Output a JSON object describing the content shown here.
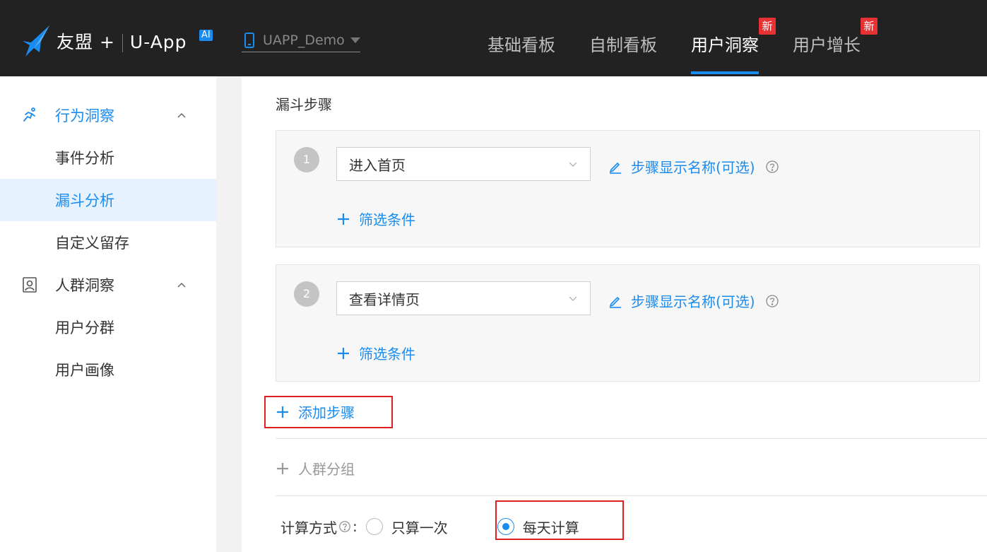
{
  "header": {
    "brand": "友盟",
    "brand_suffix": "+",
    "product": "U-App",
    "ai_badge": "AI",
    "app_selector": {
      "value": "UAPP_Demo"
    },
    "nav": [
      {
        "label": "基础看板",
        "active": false
      },
      {
        "label": "自制看板",
        "active": false
      },
      {
        "label": "用户洞察",
        "active": true,
        "badge": "新"
      },
      {
        "label": "用户增长",
        "active": false,
        "badge": "新"
      }
    ]
  },
  "sidebar": {
    "groups": [
      {
        "label": "行为洞察",
        "icon": "running-person-icon",
        "expanded": true,
        "items": [
          {
            "label": "事件分析",
            "active": false
          },
          {
            "label": "漏斗分析",
            "active": true
          },
          {
            "label": "自定义留存",
            "active": false
          }
        ]
      },
      {
        "label": "人群洞察",
        "icon": "user-card-icon",
        "expanded": true,
        "items": [
          {
            "label": "用户分群",
            "active": false
          },
          {
            "label": "用户画像",
            "active": false
          }
        ]
      }
    ]
  },
  "main": {
    "section_title": "漏斗步骤",
    "steps": [
      {
        "number": "1",
        "event": "进入首页",
        "alias_link": "步骤显示名称(可选)",
        "filter_link": "筛选条件"
      },
      {
        "number": "2",
        "event": "查看详情页",
        "alias_link": "步骤显示名称(可选)",
        "filter_link": "筛选条件"
      }
    ],
    "add_step": "添加步骤",
    "crowd_group": "人群分组",
    "calc_method": {
      "label": "计算方式",
      "colon": ":",
      "options": [
        {
          "label": "只算一次",
          "selected": false
        },
        {
          "label": "每天计算",
          "selected": true
        }
      ]
    }
  },
  "colors": {
    "accent": "#1a8cf0",
    "header_bg": "#222222",
    "badge_red": "#e63232",
    "highlight_red": "#e02020",
    "active_bg": "#e6f2fd"
  }
}
